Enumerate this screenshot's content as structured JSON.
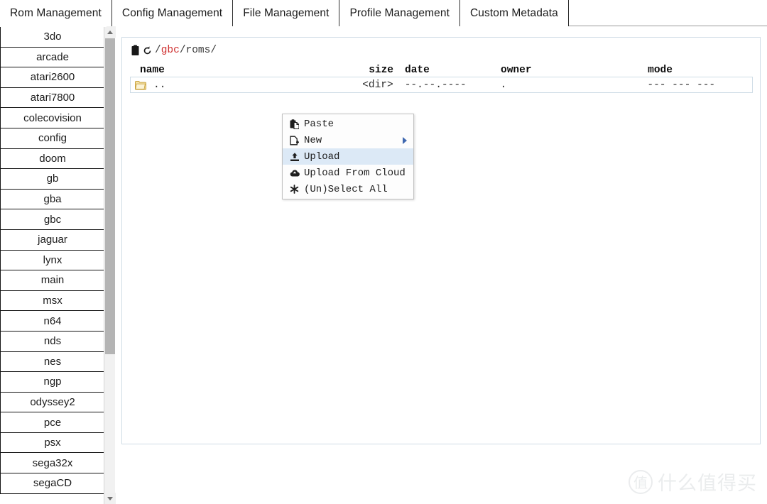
{
  "tabs": [
    {
      "label": "Rom Management",
      "active": true
    },
    {
      "label": "Config Management",
      "active": false
    },
    {
      "label": "File Management",
      "active": false
    },
    {
      "label": "Profile Management",
      "active": false
    },
    {
      "label": "Custom Metadata",
      "active": false
    }
  ],
  "sidebar": {
    "items": [
      {
        "label": "3do"
      },
      {
        "label": "arcade"
      },
      {
        "label": "atari2600"
      },
      {
        "label": "atari7800"
      },
      {
        "label": "colecovision"
      },
      {
        "label": "config"
      },
      {
        "label": "doom"
      },
      {
        "label": "gb"
      },
      {
        "label": "gba"
      },
      {
        "label": "gbc"
      },
      {
        "label": "jaguar"
      },
      {
        "label": "lynx"
      },
      {
        "label": "main"
      },
      {
        "label": "msx"
      },
      {
        "label": "n64"
      },
      {
        "label": "nds"
      },
      {
        "label": "nes"
      },
      {
        "label": "ngp"
      },
      {
        "label": "odyssey2"
      },
      {
        "label": "pce"
      },
      {
        "label": "psx"
      },
      {
        "label": "sega32x"
      },
      {
        "label": "segaCD"
      }
    ]
  },
  "breadcrumb": {
    "clipboard_icon": "clipboard-icon",
    "refresh_icon": "refresh-icon",
    "segments": [
      {
        "sep": "/",
        "name": "gbc",
        "highlight": true
      },
      {
        "sep": "/",
        "name": "roms",
        "highlight": false
      },
      {
        "sep": "/",
        "name": "",
        "highlight": false
      }
    ],
    "full_path": "/gbc/roms/"
  },
  "filelist": {
    "columns": [
      "name",
      "size",
      "date",
      "owner",
      "mode"
    ],
    "rows": [
      {
        "icon": "folder-icon",
        "name": "..",
        "size": "<dir>",
        "date": "--.--.----",
        "owner": ".",
        "mode": "--- --- ---"
      }
    ]
  },
  "context_menu": {
    "items": [
      {
        "label": "Paste",
        "icon": "paste-icon",
        "selected": false,
        "submenu": false
      },
      {
        "label": "New",
        "icon": "new-file-icon",
        "selected": false,
        "submenu": true
      },
      {
        "label": "Upload",
        "icon": "upload-icon",
        "selected": true,
        "submenu": false
      },
      {
        "label": "Upload From Cloud",
        "icon": "cloud-upload-icon",
        "selected": false,
        "submenu": false
      },
      {
        "label": "(Un)Select All",
        "icon": "asterisk-icon",
        "selected": false,
        "submenu": false
      }
    ]
  },
  "watermark": {
    "logo_char": "值",
    "text": "什么值得买"
  },
  "colors": {
    "accent_path": "#cf3030",
    "menu_highlight": "#dce9f6",
    "panel_border": "#cfdce6",
    "submenu_arrow": "#3f68b0"
  }
}
